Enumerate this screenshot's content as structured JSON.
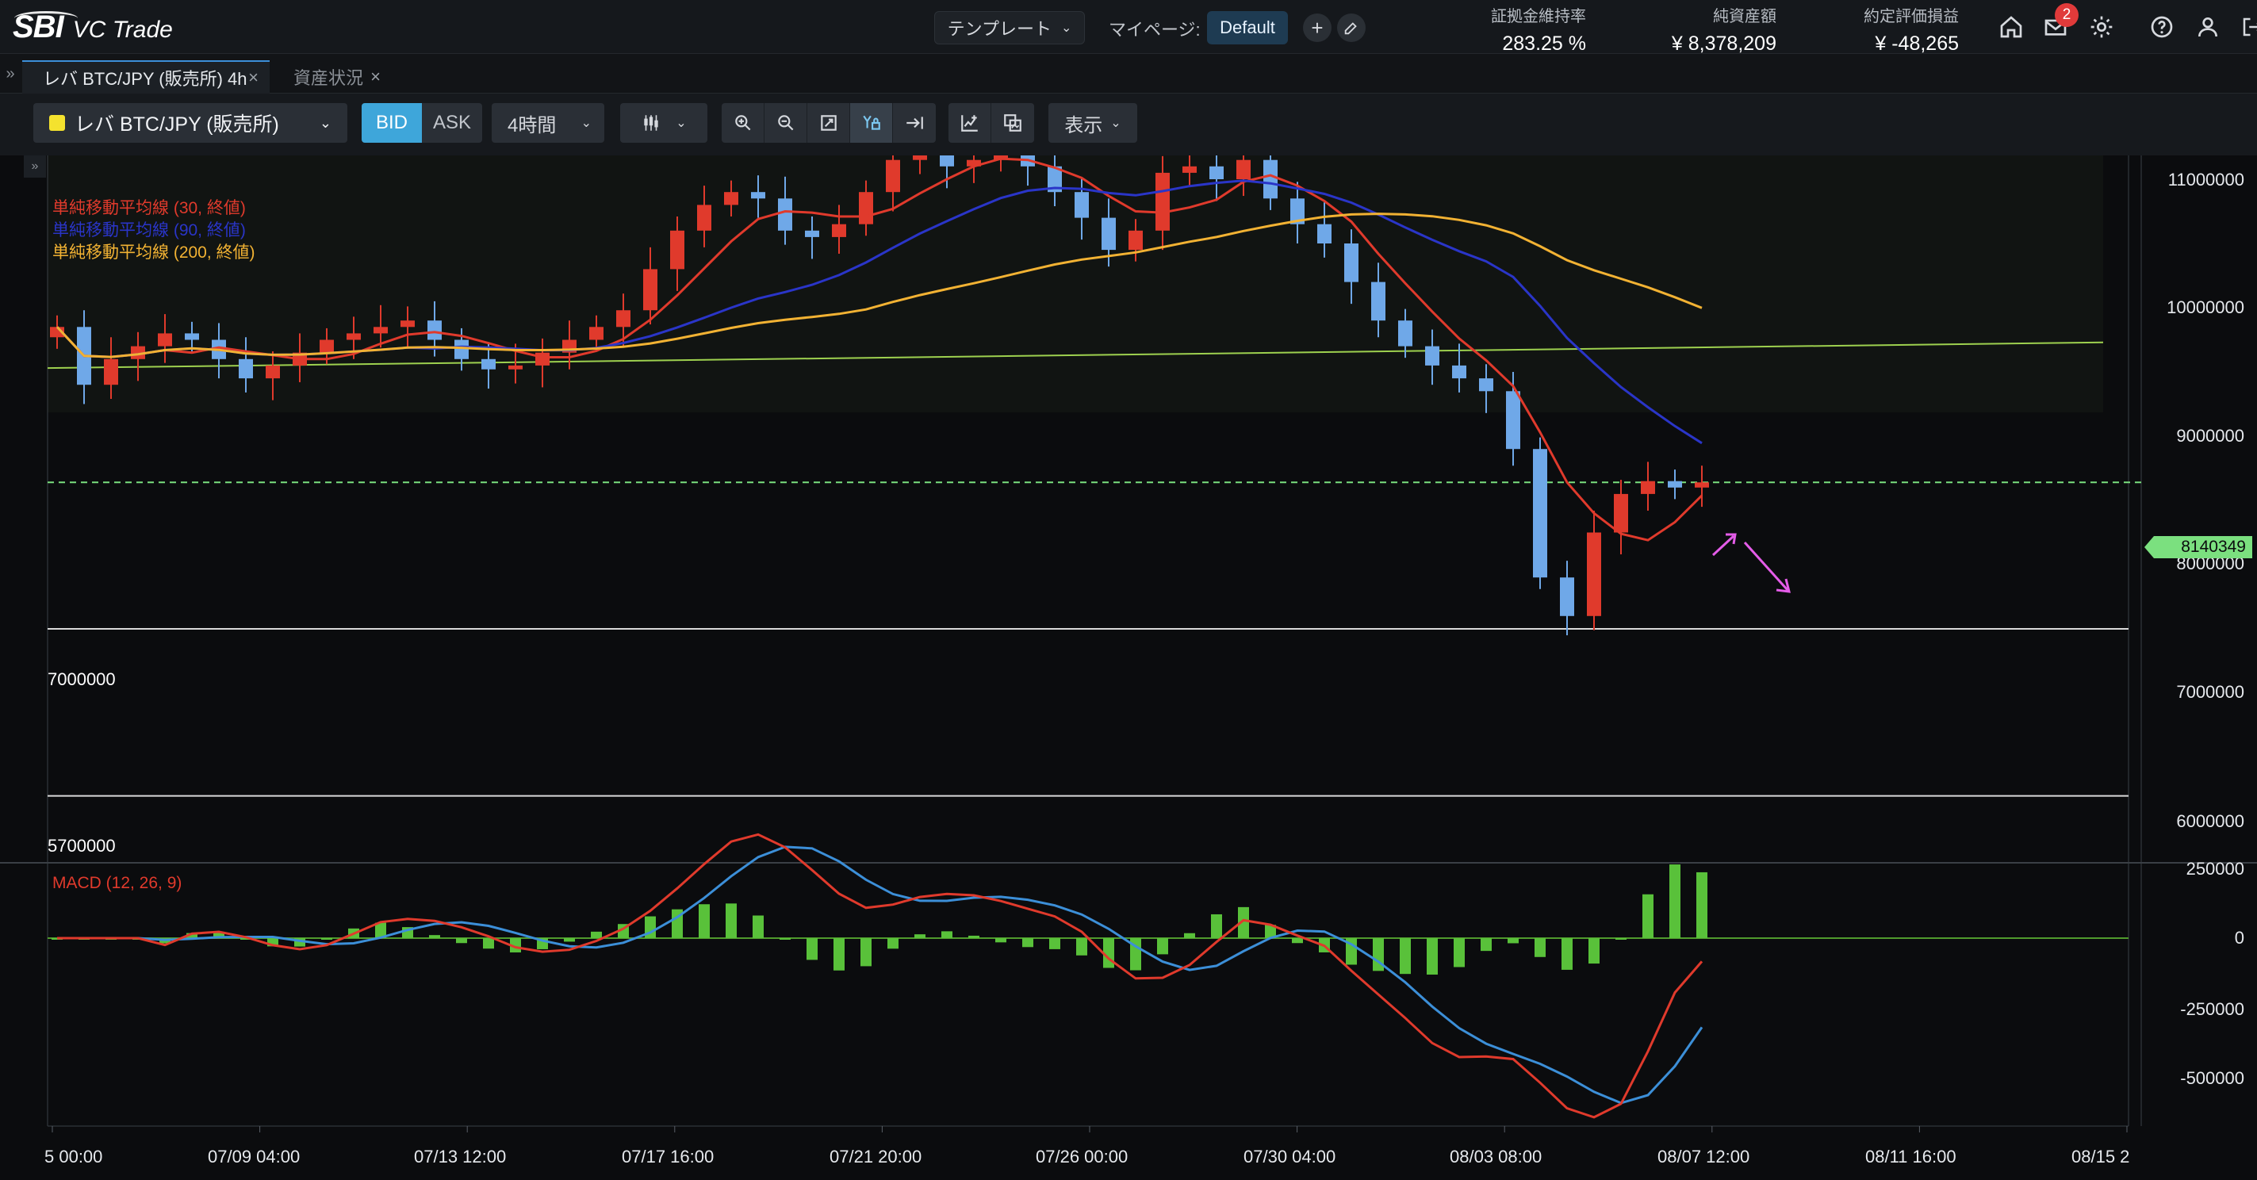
{
  "brand": {
    "logo": "SBI",
    "name": "VC Trade"
  },
  "header": {
    "template_label": "テンプレート",
    "mypage_label": "マイページ:",
    "default_label": "Default",
    "add_label": "+",
    "stats": {
      "margin_label": "証拠金維持率",
      "margin_value": "283.25 %",
      "assets_label": "純資産額",
      "assets_value": "¥ 8,378,209",
      "pnl_label": "約定評価損益",
      "pnl_value": "¥ -48,265"
    },
    "mail_badge": "2",
    "icons": [
      "home-icon",
      "mail-icon",
      "gear-icon",
      "help-icon",
      "user-icon",
      "logout-icon"
    ]
  },
  "tabs": [
    {
      "label": "レバ BTC/JPY (販売所) 4h",
      "active": true
    },
    {
      "label": "資産状況",
      "active": false
    }
  ],
  "toolbar": {
    "symbol": "レバ BTC/JPY (販売所)",
    "symbol_color": "#f4e22e",
    "bid_label": "BID",
    "ask_label": "ASK",
    "interval": "4時間",
    "display_label": "表示",
    "tools": [
      "zoom-in-icon",
      "zoom-out-icon",
      "fit-icon",
      "y-scale-lock-icon",
      "scroll-to-end-icon",
      "add-indicator-icon",
      "compare-icon"
    ]
  },
  "chart_data": {
    "type": "candlestick",
    "symbol": "レバ BTC/JPY (販売所)",
    "interval": "4h",
    "legend": [
      {
        "name": "単純移動平均線 (30, 終値)",
        "color": "#e03a2c"
      },
      {
        "name": "単純移動平均線 (90, 終値)",
        "color": "#2a35c8"
      },
      {
        "name": "単純移動平均線 (200, 終値)",
        "color": "#f2b233"
      }
    ],
    "y_ticks": [
      "11000000",
      "10000000",
      "9000000",
      "8000000",
      "7000000",
      "6000000"
    ],
    "ylim": [
      5700000,
      11200000
    ],
    "x_ticks": [
      "5 00:00",
      "07/09 04:00",
      "07/13 12:00",
      "07/17 16:00",
      "07/21 20:00",
      "07/26 00:00",
      "07/30 04:00",
      "08/03 08:00",
      "08/07 12:00",
      "08/11 16:00",
      "08/15 2"
    ],
    "current_price": "8140349",
    "horizontal_lines": [
      {
        "label": "7000000",
        "value": 7000000,
        "color": "#d9d9d9"
      },
      {
        "label": "5700000",
        "value": 5700000,
        "color": "#d9d9d9"
      }
    ],
    "trendline": {
      "from": 9030000,
      "to": 9230000,
      "color": "#9ed14f"
    },
    "series": [
      {
        "name": "close",
        "values": [
          9350000,
          8900000,
          9100000,
          9200000,
          9300000,
          9250000,
          9100000,
          8950000,
          9050000,
          9150000,
          9250000,
          9300000,
          9350000,
          9400000,
          9250000,
          9100000,
          9020000,
          9050000,
          9150000,
          9250000,
          9350000,
          9480000,
          9800000,
          10100000,
          10300000,
          10400000,
          10350000,
          10100000,
          10050000,
          10150000,
          10400000,
          10650000,
          10700000,
          10600000,
          10650000,
          10700000,
          10600000,
          10400000,
          10200000,
          9950000,
          10100000,
          10550000,
          10600000,
          10500000,
          10650000,
          10350000,
          10150000,
          10000000,
          9700000,
          9400000,
          9200000,
          9050000,
          8950000,
          8850000,
          8400000,
          7400000,
          7100000,
          7750000,
          8050000,
          8150000,
          8100000,
          8140349
        ]
      }
    ],
    "macd": {
      "label": "MACD (12, 26, 9)",
      "y_ticks": [
        "250000",
        "0",
        "-250000",
        "-500000"
      ],
      "ylim": [
        -620000,
        280000
      ]
    }
  }
}
